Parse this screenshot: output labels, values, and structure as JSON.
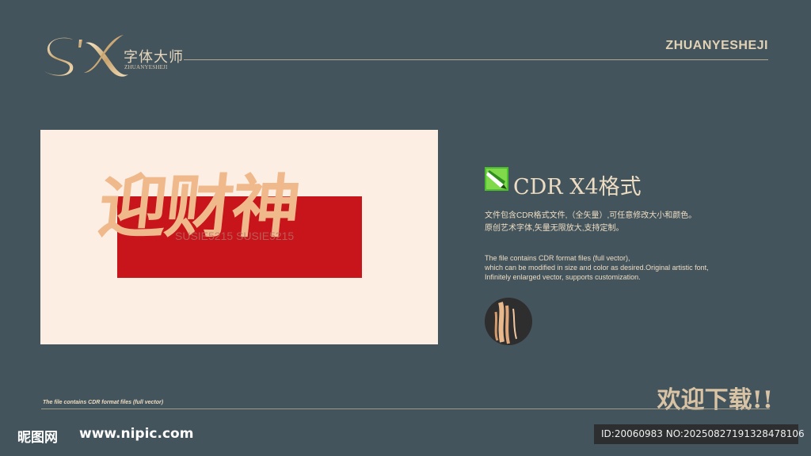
{
  "header": {
    "logo_name": "字体大师",
    "logo_sub": "ZHUANYESHEJI",
    "brand_right": "ZHUANYESHEJI"
  },
  "preview": {
    "art_text": "迎财神",
    "watermark": "SUSIE5215 SUSIE5215"
  },
  "format": {
    "title": "CDR X4格式",
    "desc_cn_1": "文件包含CDR格式文件,（全矢量）,可任意修改大小和颜色。",
    "desc_cn_2": "原创艺术字体,矢量无限放大,支持定制。",
    "desc_en_1": "The file contains CDR format files (full vector),",
    "desc_en_2": " which can be modified in size and color as desired.Original artistic font,",
    "desc_en_3": "Infinitely enlarged vector, supports customization."
  },
  "footer": {
    "note": "The file contains CDR format files (full vector)",
    "cta": "欢迎下载!!",
    "site_cn": "昵图网",
    "site_url": "www.nipic.com",
    "id_text": "ID:20060983 NO:20250827191328478106"
  },
  "colors": {
    "background": "#44545d",
    "gold": "#ecdcc2",
    "red": "#c8141b",
    "peach": "#f0b98c"
  }
}
